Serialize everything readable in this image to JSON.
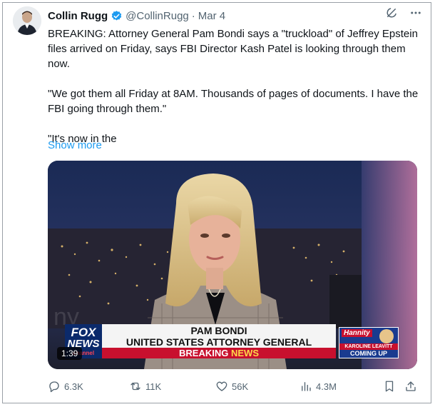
{
  "tweet": {
    "author_name": "Collin Rugg",
    "handle": "@CollinRugg",
    "separator": "·",
    "date": "Mar 4",
    "text_p1": "BREAKING: Attorney General Pam Bondi says a \"truckload\" of Jeffrey Epstein files arrived on Friday, says FBI Director Kash Patel is looking through them now.",
    "text_p2": "\"We got them all Friday at 8AM. Thousands of pages of documents. I have the FBI going through them.\"",
    "text_p3": "\"It's now in the",
    "show_more": "Show more"
  },
  "video": {
    "duration": "1:39",
    "lower_third_name": "PAM BONDI",
    "lower_third_title": "UNITED STATES ATTORNEY GENERAL",
    "breaking_left": "BREAKING",
    "breaking_right": "NEWS",
    "network_top": "FOX",
    "network_bottom": "NEWS",
    "network_sub": "channel",
    "promo_show": "Hannity",
    "promo_guest": "KAROLINE LEAVITT",
    "promo_status": "COMING UP"
  },
  "stats": {
    "replies": "6.3K",
    "reposts": "11K",
    "likes": "56K",
    "views": "4.3M"
  },
  "colors": {
    "link": "#1d9bf0",
    "verified": "#1d9bf0",
    "muted": "#536471",
    "breaking_red": "#c8102e",
    "banner_navy": "#0b2a6b"
  },
  "icons": [
    "verified-badge-icon",
    "grok-icon",
    "more-icon",
    "reply-icon",
    "repost-icon",
    "like-icon",
    "views-icon",
    "bookmark-icon",
    "share-icon"
  ]
}
